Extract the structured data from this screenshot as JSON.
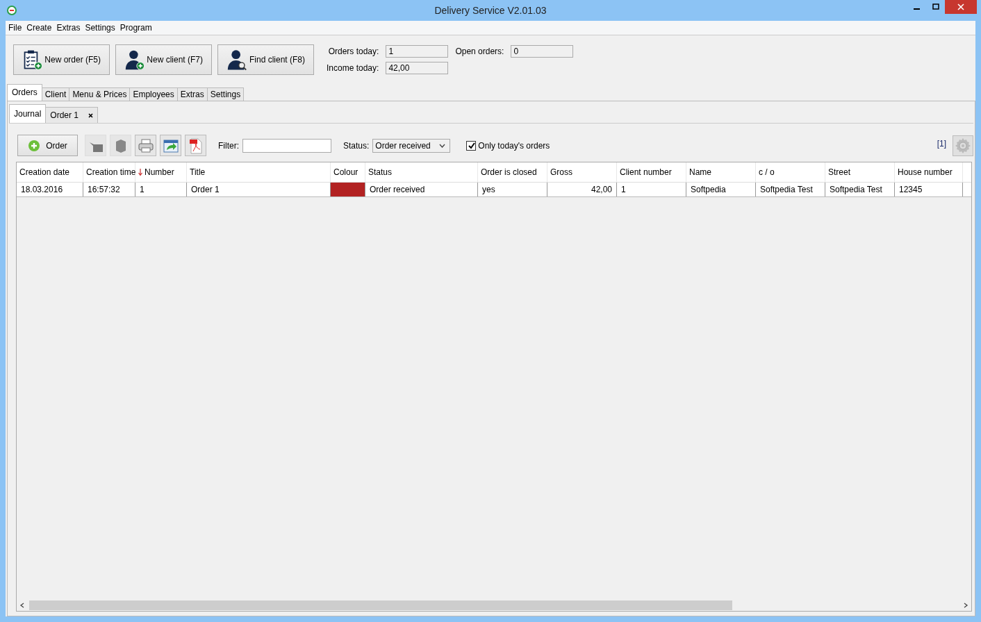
{
  "window": {
    "title": "Delivery Service V2.01.03"
  },
  "menu": [
    "File",
    "Create",
    "Extras",
    "Settings",
    "Program"
  ],
  "toolbar": [
    {
      "label": "New order (F5)",
      "kind": "order"
    },
    {
      "label": "New client (F7)",
      "kind": "client"
    },
    {
      "label": "Find client (F8)",
      "kind": "find"
    }
  ],
  "stats": {
    "orders_today": {
      "label": "Orders today:",
      "value": "1"
    },
    "open_orders": {
      "label": "Open orders:",
      "value": "0"
    },
    "income_today": {
      "label": "Income today:",
      "value": "42,00"
    }
  },
  "tabs": [
    {
      "label": "Orders",
      "selected": true
    },
    {
      "label": "Client",
      "selected": false
    },
    {
      "label": "Menu & Prices",
      "selected": false
    },
    {
      "label": "Employees",
      "selected": false
    },
    {
      "label": "Extras",
      "selected": false
    },
    {
      "label": "Settings",
      "selected": false
    }
  ],
  "subtabs": [
    {
      "label": "Journal",
      "selected": true,
      "closable": false
    },
    {
      "label": "Order 1",
      "selected": false,
      "closable": true
    }
  ],
  "journal": {
    "order_button": "Order",
    "filter": {
      "label": "Filter:"
    },
    "status": {
      "label": "Status:",
      "value": "Order received"
    },
    "only_today": {
      "label": "Only today's orders",
      "checked": true
    },
    "count": "[1]",
    "columns": [
      {
        "label": "Creation date",
        "sorted": false
      },
      {
        "label": "Creation time",
        "sorted": false
      },
      {
        "label": "Number",
        "sorted": true
      },
      {
        "label": "Title",
        "sorted": false
      },
      {
        "label": "Colour",
        "sorted": false
      },
      {
        "label": "Status",
        "sorted": false
      },
      {
        "label": "Order is closed",
        "sorted": false
      },
      {
        "label": "Gross",
        "sorted": false
      },
      {
        "label": "Client number",
        "sorted": false
      },
      {
        "label": "Name",
        "sorted": false
      },
      {
        "label": "c / o",
        "sorted": false
      },
      {
        "label": "Street",
        "sorted": false
      },
      {
        "label": "House number",
        "sorted": false
      }
    ],
    "rows": [
      {
        "creation_date": "18.03.2016",
        "creation_time": "16:57:32",
        "number": "1",
        "title": "Order 1",
        "color": "#b22222",
        "status": "Order received",
        "closed": "yes",
        "gross": "42,00",
        "client_number": "1",
        "name": "Softpedia",
        "c_o": "Softpedia Test",
        "street": "Softpedia Test",
        "house_number": "12345"
      }
    ]
  }
}
